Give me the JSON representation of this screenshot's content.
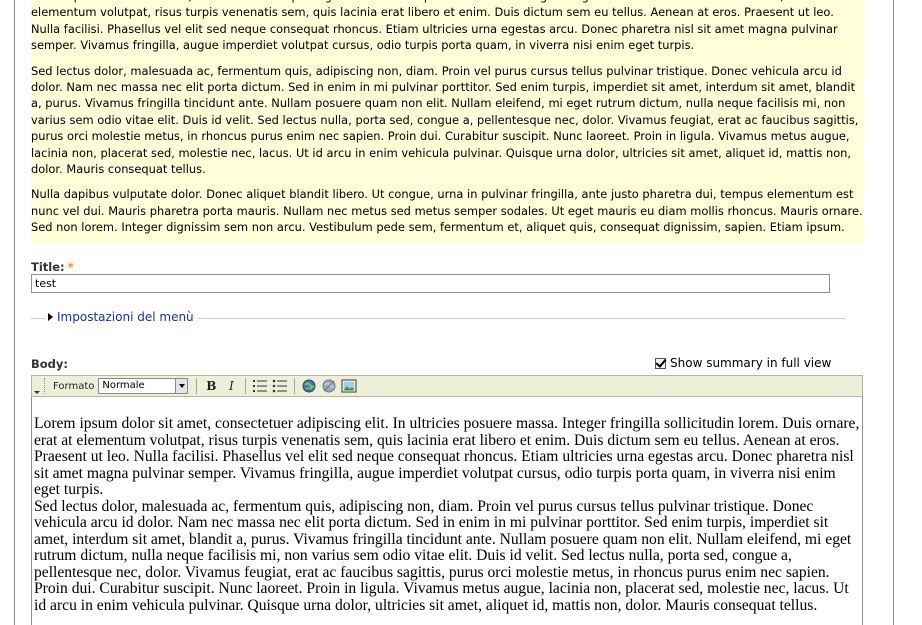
{
  "preview": {
    "paragraphs": [
      "Lorem ipsum dolor sit amet, consectetuer adipiscing elit. In ultricies posuere massa. Integer fringilla sollicitudin lorem. Duis ornare, erat at elementum volutpat, risus turpis venenatis sem, quis lacinia erat libero et enim. Duis dictum sem eu tellus. Aenean at eros. Praesent ut leo. Nulla facilisi. Phasellus vel elit sed neque consequat rhoncus. Etiam ultricies urna egestas arcu. Donec pharetra nisl sit amet magna pulvinar semper. Vivamus fringilla, augue imperdiet volutpat cursus, odio turpis porta quam, in viverra nisi enim eget turpis.",
      "Sed lectus dolor, malesuada ac, fermentum quis, adipiscing non, diam. Proin vel purus cursus tellus pulvinar tristique. Donec vehicula arcu id dolor. Nam nec massa nec elit porta dictum. Sed in enim in mi pulvinar porttitor. Sed enim turpis, imperdiet sit amet, interdum sit amet, blandit a, purus. Vivamus fringilla tincidunt ante. Nullam posuere quam non elit. Nullam eleifend, mi eget rutrum dictum, nulla neque facilisis mi, non varius sem odio vitae elit. Duis id velit. Sed lectus nulla, porta sed, congue a, pellentesque nec, dolor. Vivamus feugiat, erat ac faucibus sagittis, purus orci molestie metus, in rhoncus purus enim nec sapien. Proin dui. Curabitur suscipit. Nunc laoreet. Proin in ligula. Vivamus metus augue, lacinia non, placerat sed, molestie nec, lacus. Ut id arcu in enim vehicula pulvinar. Quisque urna dolor, ultricies sit amet, aliquet id, mattis non, dolor. Mauris consequat tellus.",
      "Nulla dapibus vulputate dolor. Donec aliquet blandit libero. Ut congue, urna in pulvinar fringilla, ante justo pharetra dui, tempus elementum est nunc vel dui. Mauris pharetra porta mauris. Nullam nec metus sed metus semper sodales. Ut eget mauris eu diam mollis rhoncus. Mauris ornare. Sed non lorem. Integer dignissim sem non arcu. Vestibulum pede sem, fermentum et, aliquet quis, consequat dignissim, sapien. Etiam ipsum."
    ]
  },
  "title_field": {
    "label": "Title:",
    "required_mark": "*",
    "value": "test"
  },
  "menu_settings": {
    "legend": "Impostazioni del menù"
  },
  "body_field": {
    "label": "Body:",
    "summary_label": "Show summary in full view",
    "summary_checked": true
  },
  "toolbar": {
    "format_label": "Formato",
    "format_value": "Normale",
    "bold_label": "B",
    "italic_label": "I",
    "icons": [
      "numbered-list-icon",
      "bulleted-list-icon",
      "link-icon",
      "unlink-icon",
      "image-icon"
    ]
  },
  "editor": {
    "paragraphs": [
      "Lorem ipsum dolor sit amet, consectetuer adipiscing elit. In ultricies posuere massa. Integer fringilla sollicitudin lorem. Duis ornare, erat at elementum volutpat, risus turpis venenatis sem, quis lacinia erat libero et enim. Duis dictum sem eu tellus. Aenean at eros. Praesent ut leo. Nulla facilisi. Phasellus vel elit sed neque consequat rhoncus. Etiam ultricies urna egestas arcu. Donec pharetra nisl sit amet magna pulvinar semper. Vivamus fringilla, augue imperdiet volutpat cursus, odio turpis porta quam, in viverra nisi enim eget turpis.",
      "Sed lectus dolor, malesuada ac, fermentum quis, adipiscing non, diam. Proin vel purus cursus tellus pulvinar tristique. Donec vehicula arcu id dolor. Nam nec massa nec elit porta dictum. Sed in enim in mi pulvinar porttitor. Sed enim turpis, imperdiet sit amet, interdum sit amet, blandit a, purus. Vivamus fringilla tincidunt ante. Nullam posuere quam non elit. Nullam eleifend, mi eget rutrum dictum, nulla neque facilisis mi, non varius sem odio vitae elit. Duis id velit. Sed lectus nulla, porta sed, congue a, pellentesque nec, dolor. Vivamus feugiat, erat ac faucibus sagittis, purus orci molestie metus, in rhoncus purus enim nec sapien. Proin dui. Curabitur suscipit. Nunc laoreet. Proin in ligula. Vivamus metus augue, lacinia non, placerat sed, molestie nec, lacus. Ut id arcu in enim vehicula pulvinar. Quisque urna dolor, ultricies sit amet, aliquet id, mattis non, dolor. Mauris consequat tellus."
    ]
  },
  "colors": {
    "preview_background": "#fffed8",
    "link": "#1a2fb8",
    "required": "#f09030",
    "toolbar_background": "#eeefd9"
  }
}
